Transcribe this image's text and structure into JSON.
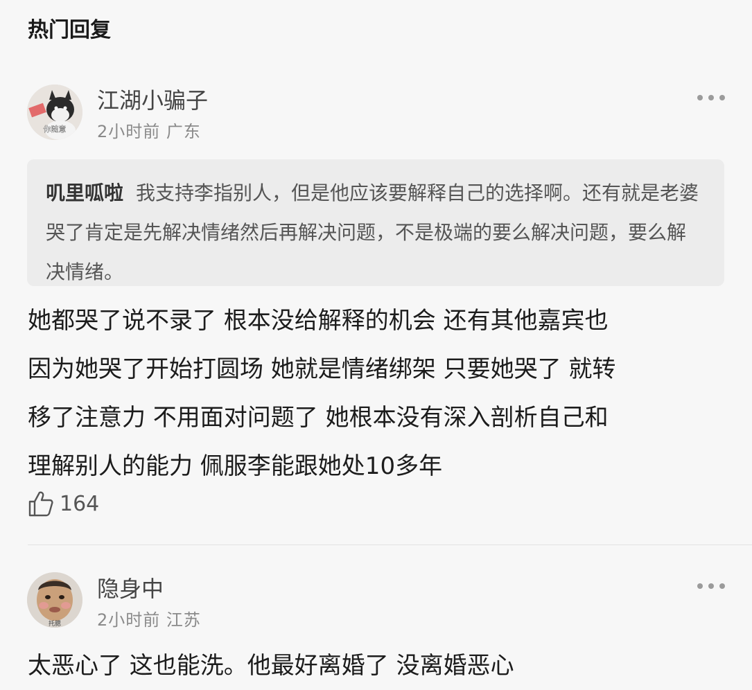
{
  "section": {
    "title": "热门回复"
  },
  "comments": [
    {
      "username": "江湖小骗子",
      "time": "2小时前",
      "location": "广东",
      "avatar_caption": "你随意",
      "quote": {
        "author": "叽里呱啦",
        "text": "我支持李指别人，但是他应该要解释自己的选择啊。还有就是老婆哭了肯定是先解决情绪然后再解决问题，不是极端的要么解决问题，要么解决情绪。"
      },
      "body_lines": [
        "她都哭了说不录了 根本没给解释的机会 还有其他嘉宾也",
        "因为她哭了开始打圆场 她就是情绪绑架 只要她哭了 就转",
        "移了注意力 不用面对问题了 她根本没有深入剖析自己和",
        "理解别人的能力 佩服李能跟她处10多年"
      ],
      "likes": "164",
      "like_icon": "thumbs-up-icon",
      "more_icon": "more-dots-icon"
    },
    {
      "username": "隐身中",
      "time": "2小时前",
      "location": "江苏",
      "avatar_caption": "托腮",
      "body_lines": [
        "太恶心了 这也能洗。他最好离婚了 没离婚恶心"
      ],
      "more_icon": "more-dots-icon"
    }
  ],
  "colors": {
    "background": "#f7f7f7",
    "quote_bg": "#ececec",
    "meta": "#8a8a8a"
  }
}
